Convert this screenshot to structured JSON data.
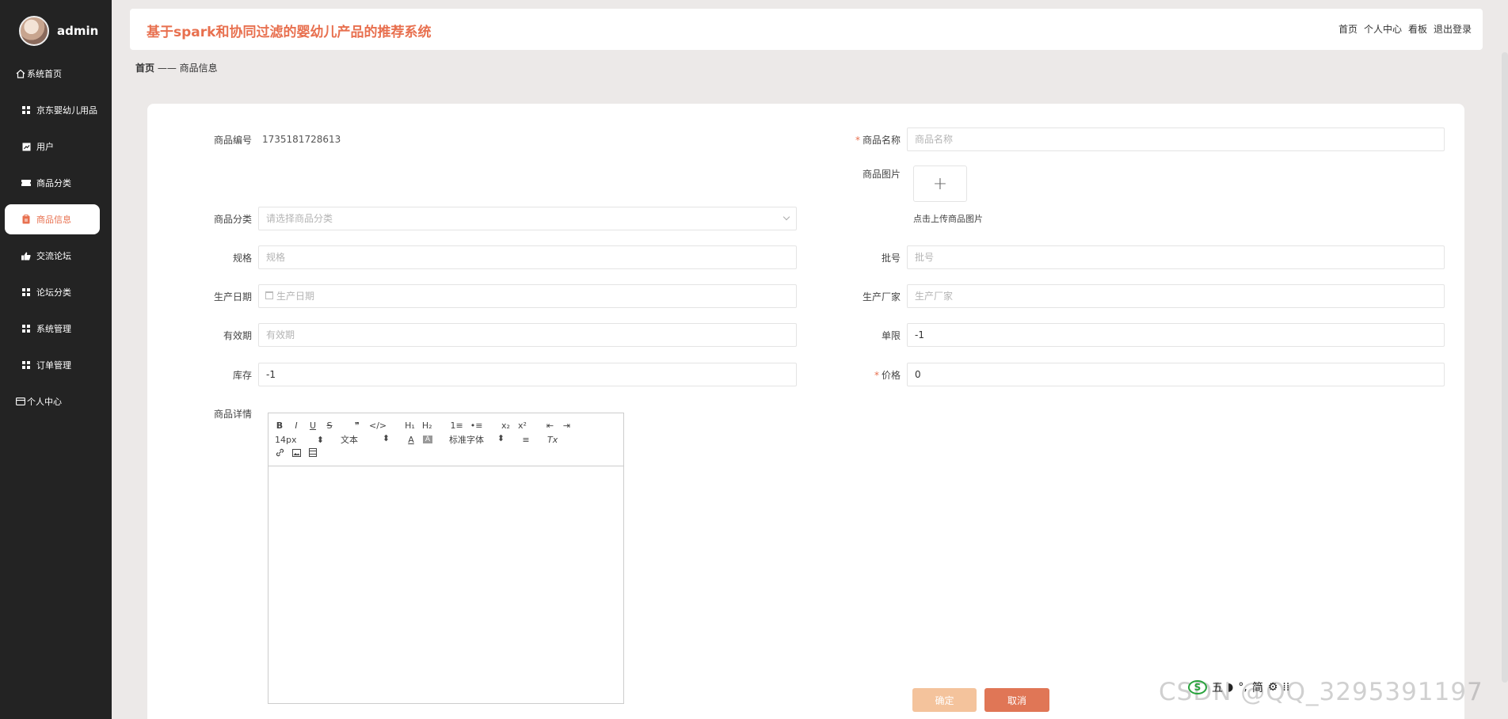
{
  "sidebar": {
    "username": "admin",
    "items": [
      {
        "label": "系统首页",
        "icon": "home-icon",
        "active": false
      },
      {
        "label": "京东婴幼儿用品",
        "icon": "grid-icon",
        "active": false
      },
      {
        "label": "用户",
        "icon": "chart-icon",
        "active": false
      },
      {
        "label": "商品分类",
        "icon": "ticket-icon",
        "active": false
      },
      {
        "label": "商品信息",
        "icon": "clipboard-icon",
        "active": true
      },
      {
        "label": "交流论坛",
        "icon": "thumb-icon",
        "active": false
      },
      {
        "label": "论坛分类",
        "icon": "grid-icon",
        "active": false
      },
      {
        "label": "系统管理",
        "icon": "grid-icon",
        "active": false
      },
      {
        "label": "订单管理",
        "icon": "grid-icon",
        "active": false
      },
      {
        "label": "个人中心",
        "icon": "card-icon",
        "active": false
      }
    ]
  },
  "header": {
    "title": "基于spark和协同过滤的婴幼儿产品的推荐系统",
    "nav": [
      "首页",
      "个人中心",
      "看板",
      "退出登录"
    ]
  },
  "breadcrumb": {
    "home": "首页",
    "separator": "——",
    "current": "商品信息"
  },
  "form": {
    "product_id": {
      "label": "商品编号",
      "value": "1735181728613"
    },
    "product_name": {
      "label": "商品名称",
      "placeholder": "商品名称",
      "required": true
    },
    "product_image": {
      "label": "商品图片",
      "upload_symbol": "+",
      "hint": "点击上传商品图片"
    },
    "category": {
      "label": "商品分类",
      "placeholder": "请选择商品分类"
    },
    "spec": {
      "label": "规格",
      "placeholder": "规格"
    },
    "batch": {
      "label": "批号",
      "placeholder": "批号"
    },
    "production_date": {
      "label": "生产日期",
      "placeholder": "生产日期"
    },
    "manufacturer": {
      "label": "生产厂家",
      "placeholder": "生产厂家"
    },
    "expiry": {
      "label": "有效期",
      "placeholder": "有效期"
    },
    "limit": {
      "label": "单限",
      "value": "-1"
    },
    "stock": {
      "label": "库存",
      "value": "-1"
    },
    "price": {
      "label": "价格",
      "value": "0",
      "required": true
    },
    "details": {
      "label": "商品详情"
    }
  },
  "editor": {
    "toolbar_row1": [
      "B",
      "I",
      "U",
      "S",
      "❞",
      "</>",
      "H₁",
      "H₂",
      "1≡",
      "•≡",
      "x₂",
      "x²",
      "⇤",
      "⇥"
    ],
    "font_size": "14px",
    "text_style": "文本",
    "font_family": "标准字体",
    "color_label": "A",
    "bg_label": "A",
    "align": "≡",
    "clear": "Tx"
  },
  "buttons": {
    "confirm": "确定",
    "cancel": "取消"
  },
  "watermark": "CSDN @QQ_3295391197",
  "ime": {
    "logo": "S",
    "items": [
      "五",
      "◗",
      "°,",
      "简",
      "⚙",
      "⁞⁞"
    ]
  },
  "colors": {
    "accent": "#e8704f",
    "sidebar_bg": "#232323",
    "confirm_bg": "#f4c39c",
    "cancel_bg": "#e07656"
  }
}
